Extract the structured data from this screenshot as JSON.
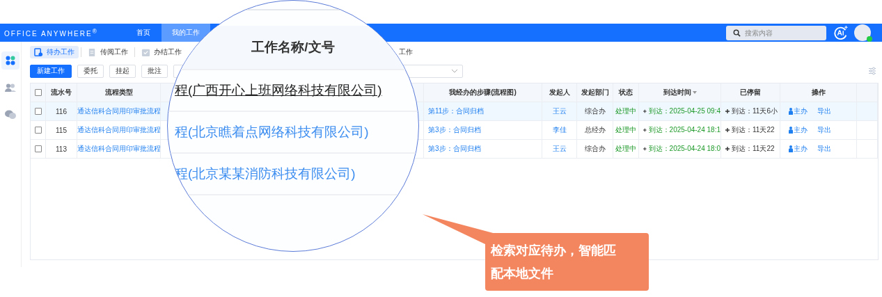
{
  "header": {
    "logo": "OFFICE ANYWHERE",
    "logo_mark": "®",
    "nav": [
      {
        "label": "首页",
        "selected": false
      },
      {
        "label": "我的工作",
        "selected": true
      }
    ],
    "search": {
      "placeholder": "搜索内容"
    }
  },
  "sidebar": {
    "items": [
      {
        "kind": "apps",
        "selected": true
      },
      {
        "kind": "users",
        "selected": false
      },
      {
        "kind": "chat",
        "selected": false
      }
    ]
  },
  "tabs": [
    {
      "label": "待办工作",
      "kind": "todo",
      "selected": true
    },
    {
      "label": "传阅工作",
      "kind": "doc",
      "selected": false
    },
    {
      "label": "办结工作",
      "kind": "done",
      "selected": false
    },
    {
      "label": "工作",
      "kind": "none",
      "selected": false
    }
  ],
  "toolbar": {
    "buttons": [
      {
        "label": "新建工作",
        "kind": "primary"
      },
      {
        "label": "委托",
        "kind": "plain"
      },
      {
        "label": "挂起",
        "kind": "plain"
      },
      {
        "label": "批注",
        "kind": "plain"
      }
    ]
  },
  "table": {
    "all_checked": false,
    "columns": [
      {
        "label": "流水号",
        "kind": "plain"
      },
      {
        "label": "流程类型",
        "kind": "plain"
      },
      {
        "label": "我经办的步骤(流程图)",
        "kind": "plain"
      },
      {
        "label": "发起人",
        "kind": "plain"
      },
      {
        "label": "发起部门",
        "kind": "plain"
      },
      {
        "label": "状态",
        "kind": "plain"
      },
      {
        "label": "到达时间",
        "kind": "sortable"
      },
      {
        "label": "已停留",
        "kind": "plain"
      },
      {
        "label": "操作",
        "kind": "plain"
      }
    ],
    "rows": [
      {
        "selected": true,
        "checked": false,
        "serial": "116",
        "type": "通达信科合同用印审批流程",
        "step": "第11步：合同归档",
        "initiator": "王云",
        "dept": "综合办",
        "status": "处理中",
        "arrival": "到达：2025-04-25 09:4",
        "stayed": "到达：11天6小",
        "actions": [
          "主办",
          "导出"
        ]
      },
      {
        "selected": false,
        "checked": false,
        "serial": "115",
        "type": "通达信科合同用印审批流程",
        "step": "第3步：合同归档",
        "initiator": "李佳",
        "dept": "总经办",
        "status": "处理中",
        "arrival": "到达：2025-04-24 18:1",
        "stayed": "到达：11天22",
        "actions": [
          "主办",
          "导出"
        ]
      },
      {
        "selected": false,
        "checked": false,
        "serial": "113",
        "type": "通达信科合同用印审批流程",
        "step": "第3步：合同归档",
        "initiator": "王云",
        "dept": "综合办",
        "status": "处理中",
        "arrival": "到达：2025-04-24 18:0",
        "stayed": "到达：11天22",
        "actions": [
          "主办",
          "导出"
        ]
      }
    ]
  },
  "magnifier": {
    "heading": "工作名称/文号",
    "rows": [
      {
        "text": "程(广西开心上班网络科技有限公司)",
        "kind": "underlined"
      },
      {
        "text": "程(北京瞧着点网络科技有限公司)",
        "kind": "link"
      },
      {
        "text": "程(北京某某消防科技有限公司)",
        "kind": "link"
      }
    ]
  },
  "callout": {
    "text": "检索对应待办，智能匹配本地文件"
  }
}
